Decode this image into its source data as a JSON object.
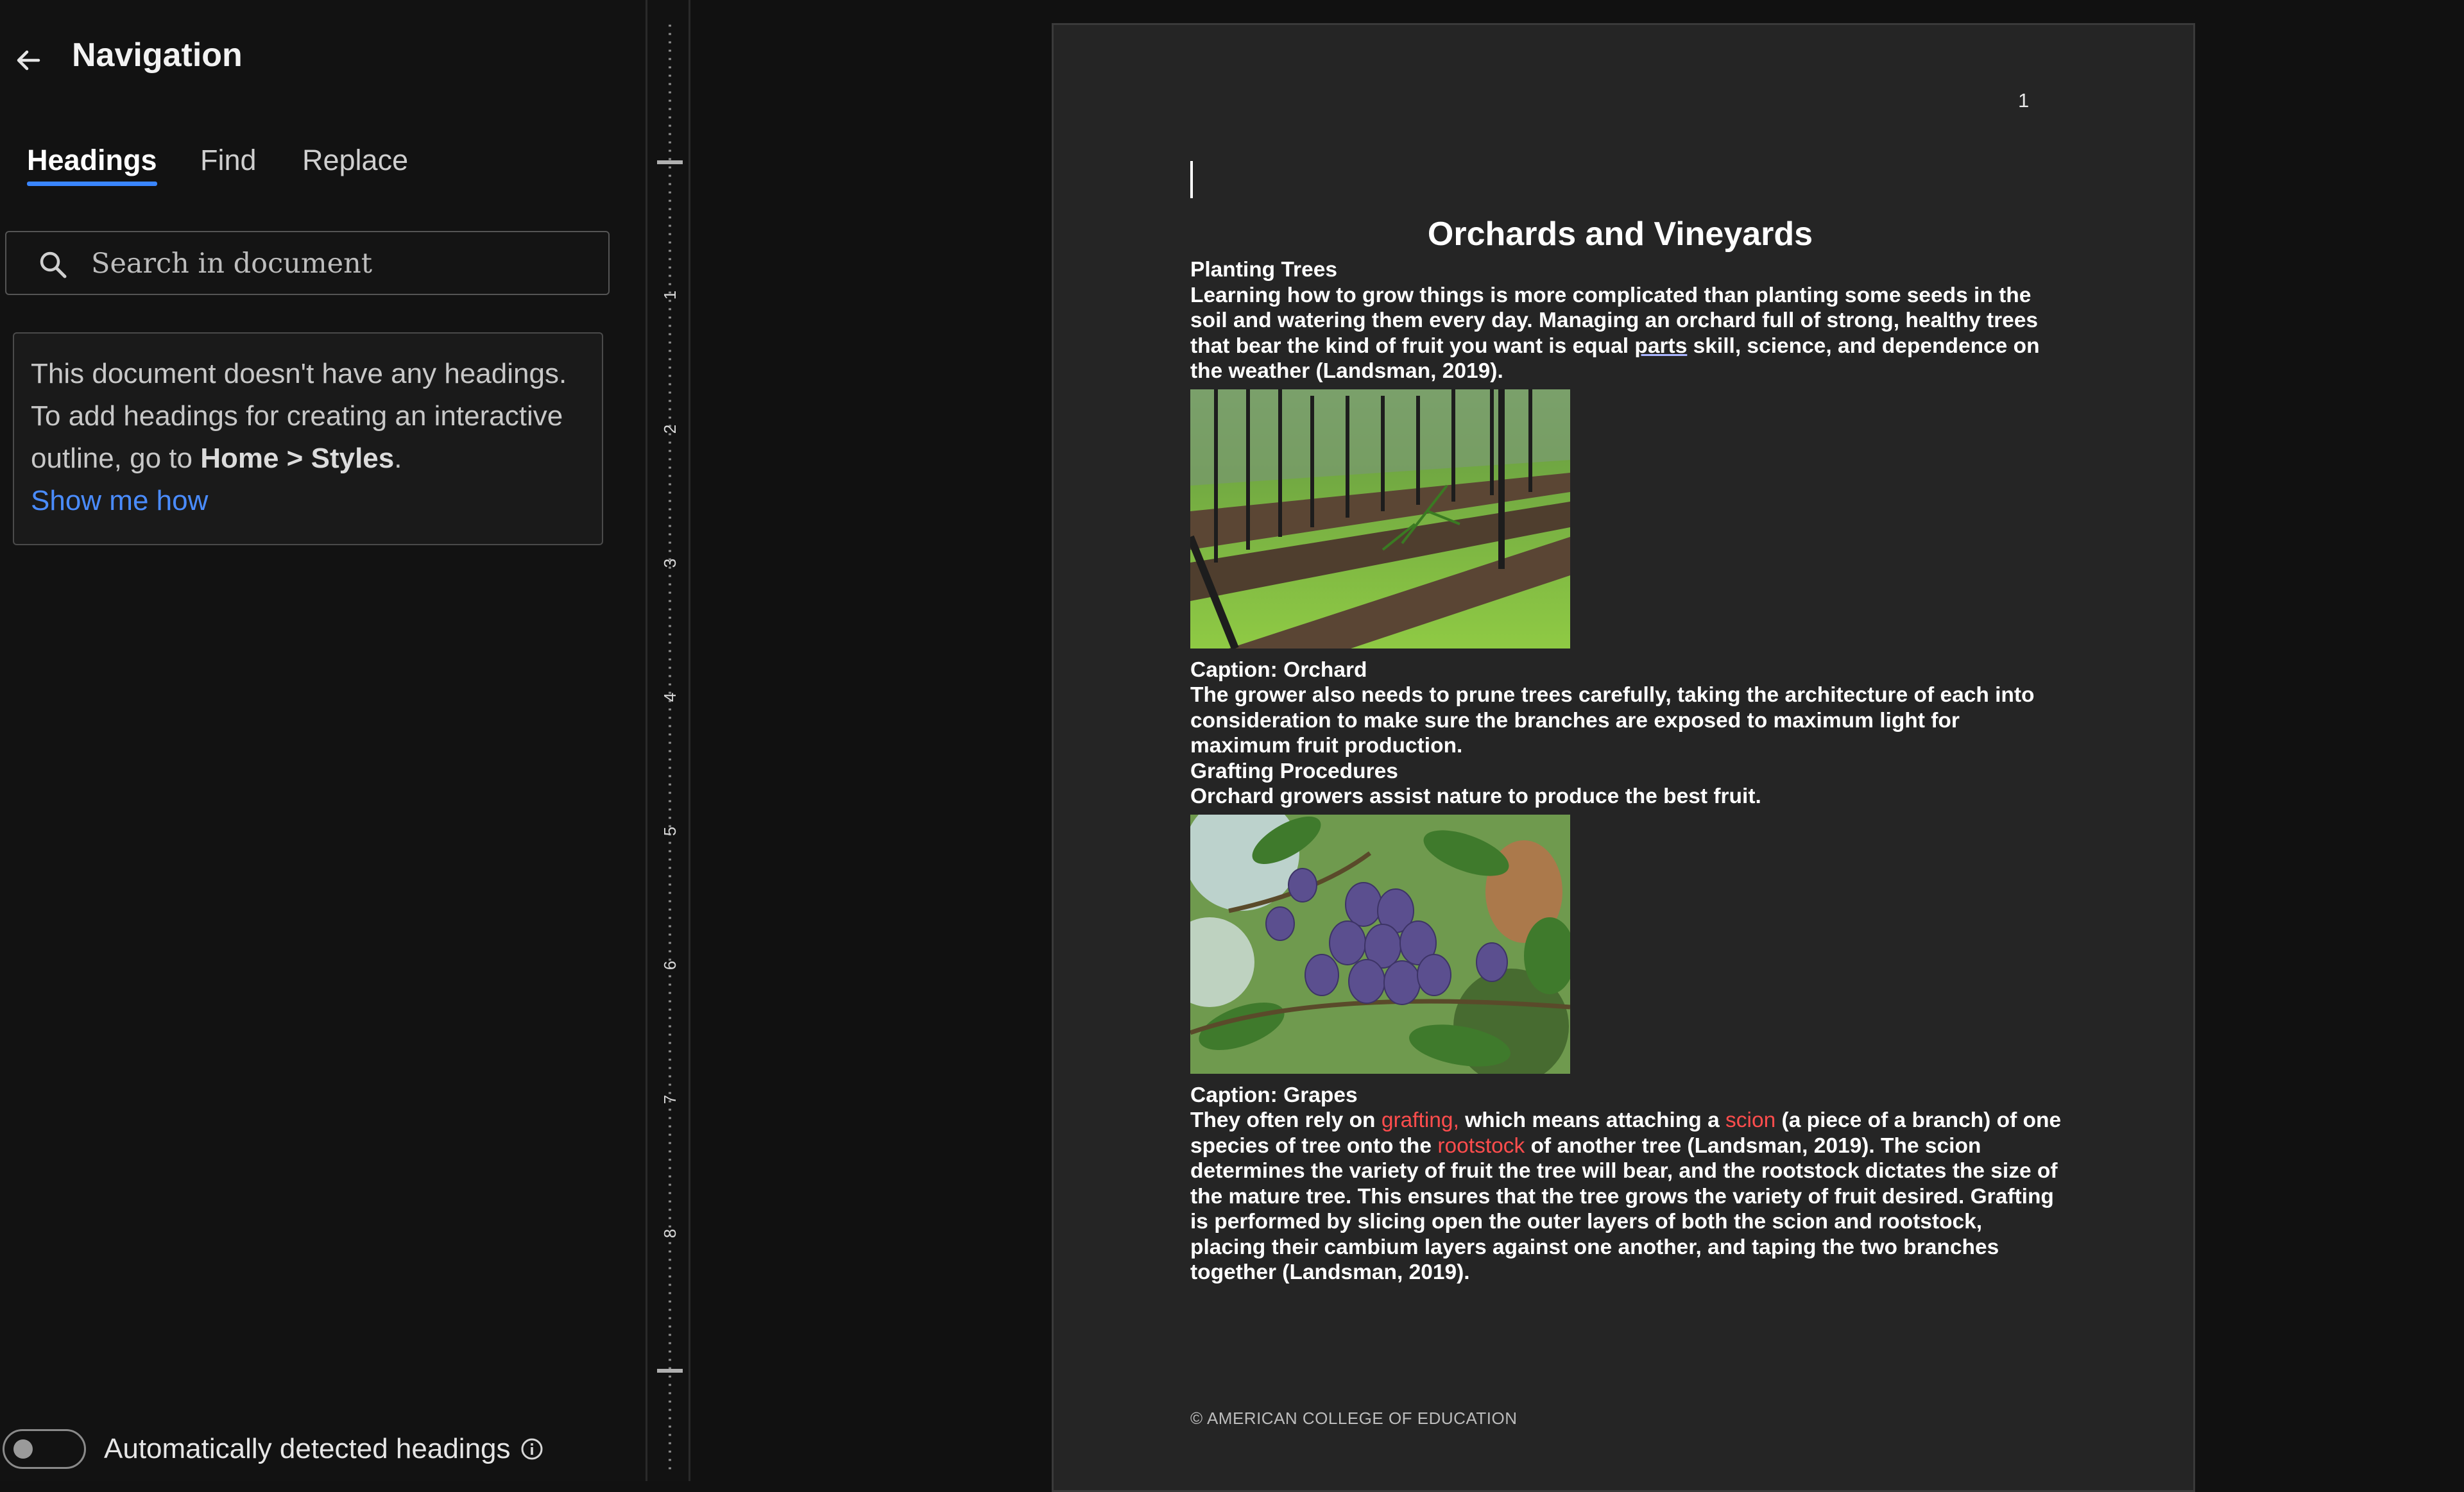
{
  "nav": {
    "title": "Navigation",
    "tabs": [
      "Headings",
      "Find",
      "Replace"
    ],
    "active_tab": "Headings",
    "search_placeholder": "Search in document",
    "info": {
      "text_before": "This document doesn't have any headings. To add headings for creating an interactive outline, go to ",
      "home": "Home",
      "separator": " > ",
      "styles": "Styles",
      "period": ".",
      "link": "Show me how"
    },
    "auto_headings_label": "Automatically detected headings",
    "auto_headings_on": false
  },
  "ruler": {
    "labels": [
      "1",
      "2",
      "3",
      "4",
      "5",
      "6",
      "7",
      "8"
    ]
  },
  "document": {
    "page_number": "1",
    "title": "Orchards and Vineyards",
    "heading1": "Planting Trees",
    "para1_before": "Learning how to grow things is more complicated than planting some seeds in the soil and watering them every day. Managing an orchard full of strong, healthy trees that bear the kind of fruit you want is equal ",
    "para1_underlined": "parts",
    "para1_after": " skill, science, and dependence on the weather (Landsman, 2019).",
    "image1_icon": "orchard-photo",
    "caption1": "Caption: Orchard",
    "para2": "The grower also needs to prune trees carefully, taking the architecture of each into consideration to make sure the branches are exposed to maximum light for maximum fruit production.",
    "heading2": "Grafting Procedures",
    "para3": "Orchard growers assist nature to produce the best fruit.",
    "image2_icon": "grapes-photo",
    "caption2": "Caption: Grapes",
    "para4": {
      "t1": "They often rely on ",
      "r1": "grafting,",
      "t2": " which means attaching a ",
      "r2": "scion",
      "t3": " (a piece of a branch) of one species of tree onto the ",
      "r3": "rootstock",
      "t4": " of another tree (Landsman, 2019). The scion determines the variety of fruit the tree will bear, and the rootstock dictates the size of the mature tree. This ensures that the tree grows the variety of fruit desired. Grafting is performed by slicing open the outer layers of both the scion and rootstock, placing their cambium layers against one another, and taping the two branches together (Landsman, 2019)."
    },
    "footer": "© AMERICAN COLLEGE OF EDUCATION"
  },
  "colors": {
    "accent": "#3a86ff",
    "link": "#4a8cff",
    "highlight_red": "#ff4d4d",
    "page_bg": "#252525"
  }
}
